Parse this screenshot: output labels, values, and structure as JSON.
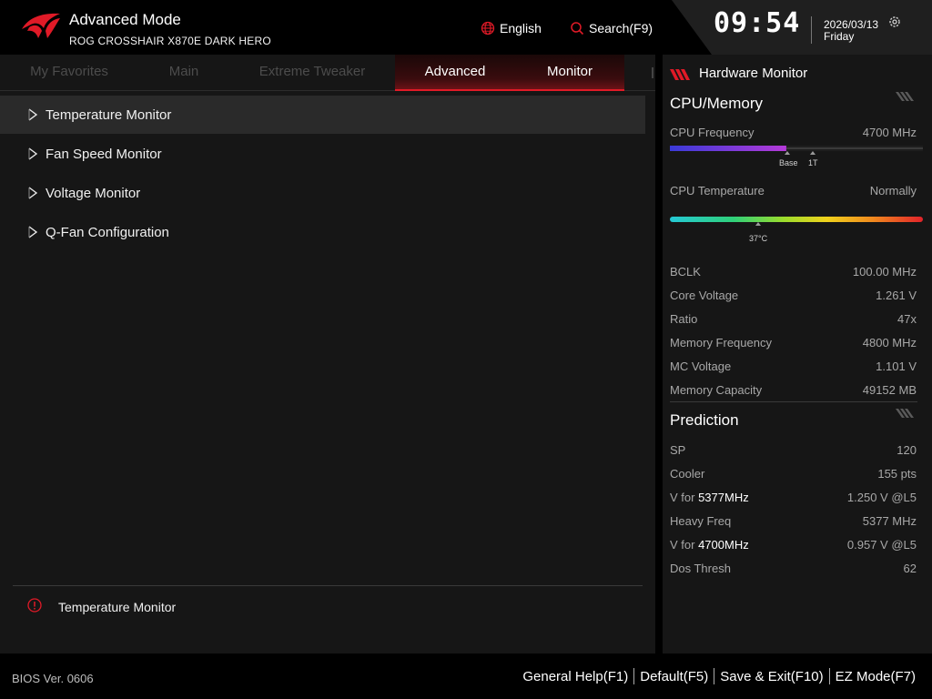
{
  "header": {
    "mode_title": "Advanced Mode",
    "board_name": "ROG CROSSHAIR X870E DARK HERO",
    "language": "English",
    "search": "Search(F9)",
    "time": "09:54",
    "date": "2026/03/13",
    "day": "Friday"
  },
  "tabs": [
    {
      "label": "My Favorites",
      "active": false
    },
    {
      "label": "Main",
      "active": false
    },
    {
      "label": "Extreme Tweaker",
      "active": false
    },
    {
      "label": "Advanced",
      "active": true
    },
    {
      "label": "Monitor",
      "active": true
    }
  ],
  "menu": [
    {
      "label": "Temperature Monitor",
      "selected": true
    },
    {
      "label": "Fan Speed Monitor",
      "selected": false
    },
    {
      "label": "Voltage Monitor",
      "selected": false
    },
    {
      "label": "Q-Fan Configuration",
      "selected": false
    }
  ],
  "help": {
    "text": "Temperature Monitor"
  },
  "hardware_monitor": {
    "title": "Hardware Monitor",
    "cpu_memory": {
      "title": "CPU/Memory",
      "cpu_frequency": {
        "label": "CPU Frequency",
        "value": "4700 MHz",
        "fill_fraction": 0.46,
        "marker_base": "Base",
        "marker_1t": "1T"
      },
      "cpu_temperature": {
        "label": "CPU Temperature",
        "value": "Normally",
        "marker": "37°C"
      },
      "rows": [
        {
          "label": "BCLK",
          "value": "100.00 MHz"
        },
        {
          "label": "Core Voltage",
          "value": "1.261 V"
        },
        {
          "label": "Ratio",
          "value": "47x"
        },
        {
          "label": "Memory Frequency",
          "value": "4800 MHz"
        },
        {
          "label": "MC Voltage",
          "value": "1.101 V"
        },
        {
          "label": "Memory Capacity",
          "value": "49152 MB"
        }
      ]
    },
    "prediction": {
      "title": "Prediction",
      "rows": [
        {
          "label": "SP",
          "highlight": "",
          "value": "120"
        },
        {
          "label": "Cooler",
          "highlight": "",
          "value": "155 pts"
        },
        {
          "label": "V for ",
          "highlight": "5377MHz",
          "value": "1.250 V @L5"
        },
        {
          "label": "Heavy Freq",
          "highlight": "",
          "value": "5377 MHz"
        },
        {
          "label": "V for ",
          "highlight": "4700MHz",
          "value": "0.957 V @L5"
        },
        {
          "label": "Dos Thresh",
          "highlight": "",
          "value": "62"
        }
      ]
    }
  },
  "footer": {
    "bios_version": "BIOS Ver. 0606",
    "actions": [
      "General Help(F1)",
      "Default(F5)",
      "Save & Exit(F10)",
      "EZ Mode(F7)"
    ]
  },
  "colors": {
    "accent": "#e01a27",
    "panel": "#161616",
    "background": "#000000"
  }
}
